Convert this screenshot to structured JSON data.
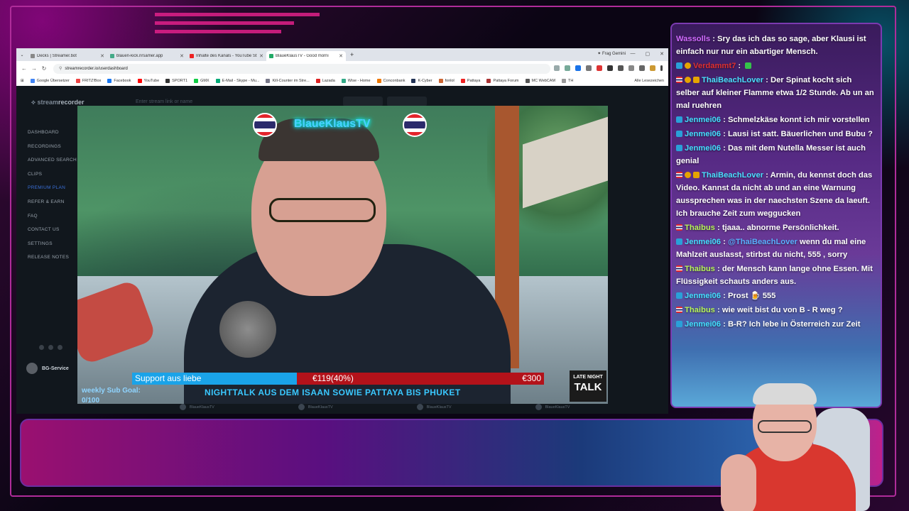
{
  "browser": {
    "tabs": [
      {
        "title": "Decks | Streamer.bot",
        "active": false
      },
      {
        "title": "blauen-kick.nrsamer.app",
        "active": false
      },
      {
        "title": "Inhalte des Kanals - YouTube St",
        "active": false
      },
      {
        "title": "BlaueKlausTV - Good morni",
        "active": true
      }
    ],
    "gemini_label": "Frag Gemini",
    "url": "streamrecorder.io/userdashboard",
    "bookmarks": [
      "Google Übersetzer",
      "FRITZ!Box",
      "Facebook",
      "YouTube",
      "SPORT1",
      "GMX",
      "E-Mail - Skype - Mu...",
      "Kill-Counter im Stre...",
      "Lazada",
      "Wise - Home",
      "Conconbank",
      "K-Cyber",
      "fonlol",
      "Pattaya",
      "Pattaya Forum",
      "MC WebCAM",
      "TH"
    ],
    "bookmarks_right": "Alle Lesezeichen"
  },
  "app": {
    "logo_prefix": "stream",
    "logo_suffix": "recorder",
    "search_placeholder": "Enter stream link or name",
    "nav": [
      "DASHBOARD",
      "RECORDINGS",
      "ADVANCED SEARCH",
      "CLIPS",
      "PREMIUM PLAN",
      "REFER & EARN",
      "FAQ",
      "CONTACT US",
      "SETTINGS",
      "RELEASE NOTES"
    ],
    "user": "BG-Service",
    "recordings": [
      "BlaueKlausTV",
      "BlaueKlausTV",
      "BlaueKlausTV",
      "BlaueKlausTV"
    ]
  },
  "stream": {
    "channel": "BlaueKlausTV",
    "goal_label": "Support aus liebe",
    "goal_current": "€119(40%)",
    "goal_target": "€300",
    "goal_progress": 0.4,
    "ticker": "NIGHTTALK AUS DEM ISAAN SOWIE PATTAYA BIS PHUKET",
    "sub_goal_label": "weekly Sub Goal:",
    "sub_goal_value": "0/100",
    "logo_line1": "LATE NIGHT",
    "logo_line2": "TALK"
  },
  "chat": [
    {
      "badges": [],
      "user": "Wassolls",
      "user_class": "u-wass",
      "text": "Sry das ich das so sage, aber Klausi ist einfach nur nur ein abartiger Mensch."
    },
    {
      "badges": [
        "b-mod",
        "b-gold"
      ],
      "user": "Verdammt7",
      "user_class": "u-vert",
      "text": "",
      "emote": "b-green"
    },
    {
      "badges": [
        "b-thai",
        "b-gold",
        "b-gift"
      ],
      "user": "ThaiBeachLover",
      "user_class": "u-thai",
      "text": "Der Spinat kocht sich selber auf kleiner Flamme etwa 1/2 Stunde. Ab un an mal ruehren"
    },
    {
      "badges": [
        "b-mod"
      ],
      "user": "Jenmei06",
      "user_class": "u-jen",
      "text": "Schmelzkäse konnt ich mir vorstellen"
    },
    {
      "badges": [
        "b-mod"
      ],
      "user": "Jenmei06",
      "user_class": "u-jen",
      "text": "Lausi ist satt. Bäuerlichen und Bubu ?"
    },
    {
      "badges": [
        "b-mod"
      ],
      "user": "Jenmei06",
      "user_class": "u-jen",
      "text": "Das mit dem Nutella Messer ist auch genial"
    },
    {
      "badges": [
        "b-thai",
        "b-gold",
        "b-gift"
      ],
      "user": "ThaiBeachLover",
      "user_class": "u-thai",
      "text": "Armin, du kennst doch das Video. Kannst da nicht ab und an eine Warnung aussprechen was in der naechsten Szene da laeuft. Ich brauche Zeit zum weggucken"
    },
    {
      "badges": [
        "b-thai"
      ],
      "user": "Thaibus",
      "user_class": "u-thaibus",
      "text": "tjaaa.. abnorme Persönlichkeit."
    },
    {
      "badges": [
        "b-mod"
      ],
      "user": "Jenmei06",
      "user_class": "u-jen",
      "mention": "@ThaiBeachLover",
      "text": "wenn du mal eine Mahlzeit auslasst, stirbst du nicht, 555 , sorry"
    },
    {
      "badges": [
        "b-thai"
      ],
      "user": "Thaibus",
      "user_class": "u-thaibus",
      "text": "der Mensch kann lange ohne Essen. Mit Flüssigkeit schauts anders aus."
    },
    {
      "badges": [
        "b-mod"
      ],
      "user": "Jenmei06",
      "user_class": "u-jen",
      "text": "Prost 🍺 555"
    },
    {
      "badges": [
        "b-thai"
      ],
      "user": "Thaibus",
      "user_class": "u-thaibus",
      "text": "wie weit bist du von B - R weg ?"
    },
    {
      "badges": [
        "b-mod"
      ],
      "user": "Jenmei06",
      "user_class": "u-jen",
      "text": "B-R? Ich lebe in Österreich zur Zeit"
    }
  ]
}
